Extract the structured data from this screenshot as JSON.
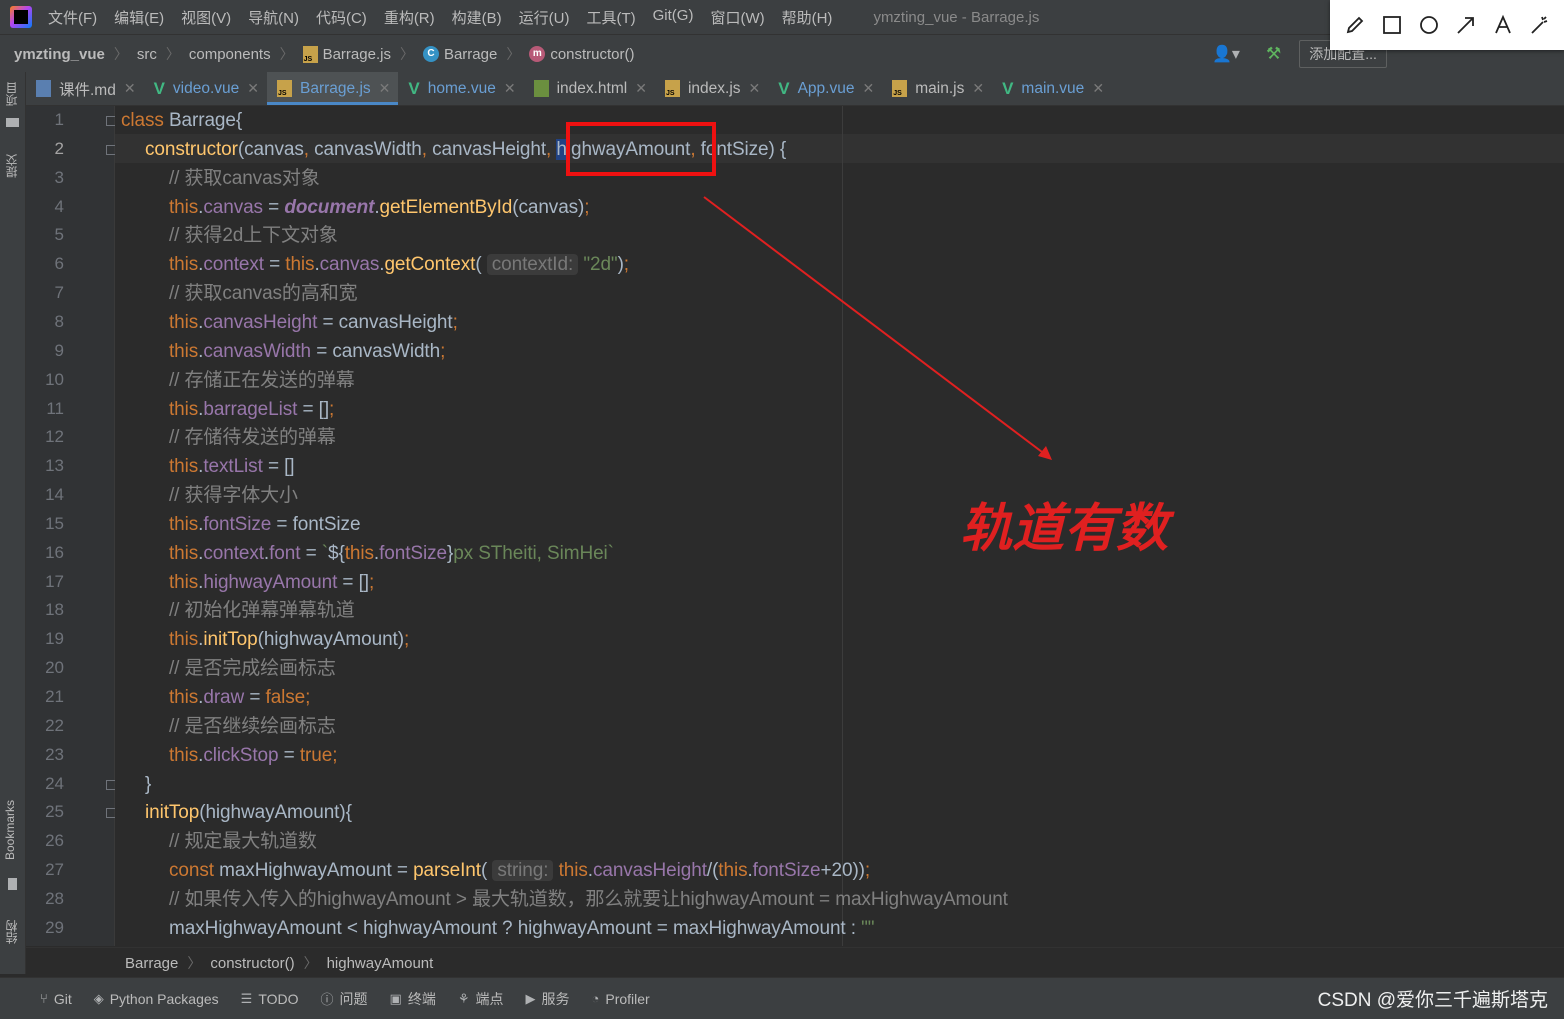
{
  "menubar": {
    "items": [
      "文件(F)",
      "编辑(E)",
      "视图(V)",
      "导航(N)",
      "代码(C)",
      "重构(R)",
      "构建(B)",
      "运行(U)",
      "工具(T)",
      "Git(G)",
      "窗口(W)",
      "帮助(H)"
    ],
    "window_title": "ymzting_vue - Barrage.js"
  },
  "annotation_tools": [
    "pencil-icon",
    "rectangle-icon",
    "circle-icon",
    "arrow-icon",
    "text-icon",
    "magic-wand-icon"
  ],
  "navbar": {
    "project": "ymzting_vue",
    "crumbs": [
      "src",
      "components",
      "Barrage.js",
      "Barrage",
      "constructor()"
    ],
    "add_config": "添加配置..."
  },
  "left_strip": {
    "project_label": "项目",
    "commit_label": "提交",
    "bookmarks_label": "Bookmarks",
    "structure_label": "结构"
  },
  "tabs": [
    {
      "name": "课件.md",
      "type": "md"
    },
    {
      "name": "video.vue",
      "type": "vue"
    },
    {
      "name": "Barrage.js",
      "type": "js",
      "active": true
    },
    {
      "name": "home.vue",
      "type": "vue"
    },
    {
      "name": "index.html",
      "type": "html"
    },
    {
      "name": "index.js",
      "type": "js"
    },
    {
      "name": "App.vue",
      "type": "vue"
    },
    {
      "name": "main.js",
      "type": "js"
    },
    {
      "name": "main.vue",
      "type": "vue"
    }
  ],
  "editor": {
    "line_numbers": [
      "1",
      "2",
      "3",
      "4",
      "5",
      "6",
      "7",
      "8",
      "9",
      "10",
      "11",
      "12",
      "13",
      "14",
      "15",
      "16",
      "17",
      "18",
      "19",
      "20",
      "21",
      "22",
      "23",
      "24",
      "25",
      "26",
      "27",
      "28",
      "29"
    ],
    "lines": [
      [
        [
          "kw",
          "class "
        ],
        [
          "",
          "Barrage{"
        ]
      ],
      [
        [
          "fn",
          "constructor"
        ],
        [
          "",
          "(canvas"
        ],
        [
          "kw",
          ", "
        ],
        [
          "",
          "canvasWidth"
        ],
        [
          "kw",
          ", "
        ],
        [
          "",
          "canvasHeight"
        ],
        [
          "kw",
          ", "
        ],
        [
          "sel",
          "h"
        ],
        [
          "",
          "ighwayAmount"
        ],
        [
          "kw",
          ", "
        ],
        [
          "",
          "fontSize) {"
        ]
      ],
      [
        [
          "cm",
          "// 获取canvas对象"
        ]
      ],
      [
        [
          "th",
          "this"
        ],
        [
          "",
          "."
        ],
        [
          "pr",
          "canvas"
        ],
        [
          "",
          " = "
        ],
        [
          "doc",
          "document"
        ],
        [
          "",
          "."
        ],
        [
          "fn",
          "getElementById"
        ],
        [
          "",
          "(canvas)"
        ],
        [
          "kw",
          ";"
        ]
      ],
      [
        [
          "cm",
          "// 获得2d上下文对象"
        ]
      ],
      [
        [
          "th",
          "this"
        ],
        [
          "",
          "."
        ],
        [
          "pr",
          "context"
        ],
        [
          "",
          " = "
        ],
        [
          "th",
          "this"
        ],
        [
          "",
          "."
        ],
        [
          "pr",
          "canvas"
        ],
        [
          "",
          "."
        ],
        [
          "fn",
          "getContext"
        ],
        [
          "",
          "( "
        ],
        [
          "hint",
          "contextId:"
        ],
        [
          "",
          " "
        ],
        [
          "str",
          "\"2d\""
        ],
        [
          "",
          ")"
        ],
        [
          "kw",
          ";"
        ]
      ],
      [
        [
          "cm",
          "// 获取canvas的高和宽"
        ]
      ],
      [
        [
          "th",
          "this"
        ],
        [
          "",
          "."
        ],
        [
          "pr",
          "canvasHeight"
        ],
        [
          "",
          " = canvasHeight"
        ],
        [
          "kw",
          ";"
        ]
      ],
      [
        [
          "th",
          "this"
        ],
        [
          "",
          "."
        ],
        [
          "pr",
          "canvasWidth"
        ],
        [
          "",
          " = canvasWidth"
        ],
        [
          "kw",
          ";"
        ]
      ],
      [
        [
          "cm",
          "// 存储正在发送的弹幕"
        ]
      ],
      [
        [
          "th",
          "this"
        ],
        [
          "",
          "."
        ],
        [
          "pr",
          "barrageList"
        ],
        [
          "",
          " = []"
        ],
        [
          "kw",
          ";"
        ]
      ],
      [
        [
          "cm",
          "// 存储待发送的弹幕"
        ]
      ],
      [
        [
          "th",
          "this"
        ],
        [
          "",
          "."
        ],
        [
          "pr",
          "textList"
        ],
        [
          "",
          " = []"
        ]
      ],
      [
        [
          "cm",
          "// 获得字体大小"
        ]
      ],
      [
        [
          "th",
          "this"
        ],
        [
          "",
          "."
        ],
        [
          "pr",
          "fontSize"
        ],
        [
          "",
          " = fontSize"
        ]
      ],
      [
        [
          "th",
          "this"
        ],
        [
          "",
          "."
        ],
        [
          "pr",
          "context"
        ],
        [
          "",
          "."
        ],
        [
          "pr",
          "font"
        ],
        [
          "",
          " = "
        ],
        [
          "str",
          "`"
        ],
        [
          "",
          "${"
        ],
        [
          "th",
          "this"
        ],
        [
          "",
          "."
        ],
        [
          "pr",
          "fontSize"
        ],
        [
          "",
          "}"
        ],
        [
          "str",
          "px STheiti, SimHei`"
        ]
      ],
      [
        [
          "th",
          "this"
        ],
        [
          "",
          "."
        ],
        [
          "pr",
          "highwayAmount"
        ],
        [
          "",
          " = []"
        ],
        [
          "kw",
          ";"
        ]
      ],
      [
        [
          "cm",
          "// 初始化弹幕弹幕轨道"
        ]
      ],
      [
        [
          "th",
          "this"
        ],
        [
          "",
          "."
        ],
        [
          "fn",
          "initTop"
        ],
        [
          "",
          "(highwayAmount)"
        ],
        [
          "kw",
          ";"
        ]
      ],
      [
        [
          "cm",
          "// 是否完成绘画标志"
        ]
      ],
      [
        [
          "th",
          "this"
        ],
        [
          "",
          "."
        ],
        [
          "pr",
          "draw"
        ],
        [
          "",
          " = "
        ],
        [
          "kw",
          "false"
        ],
        [
          "kw",
          ";"
        ]
      ],
      [
        [
          "cm",
          "// 是否继续绘画标志"
        ]
      ],
      [
        [
          "th",
          "this"
        ],
        [
          "",
          "."
        ],
        [
          "pr",
          "clickStop"
        ],
        [
          "",
          " = "
        ],
        [
          "kw",
          "true"
        ],
        [
          "kw",
          ";"
        ]
      ],
      [
        [
          "",
          "}"
        ]
      ],
      [
        [
          "fn",
          "initTop"
        ],
        [
          "",
          "(highwayAmount){"
        ]
      ],
      [
        [
          "cm",
          "// 规定最大轨道数"
        ]
      ],
      [
        [
          "kw",
          "const "
        ],
        [
          "",
          "maxHighwayAmount = "
        ],
        [
          "fn",
          "parseInt"
        ],
        [
          "",
          "( "
        ],
        [
          "hint",
          "string:"
        ],
        [
          "",
          " "
        ],
        [
          "th",
          "this"
        ],
        [
          "",
          "."
        ],
        [
          "pr",
          "canvasHeight"
        ],
        [
          "",
          "/("
        ],
        [
          "th",
          "this"
        ],
        [
          "",
          "."
        ],
        [
          "pr",
          "fontSize"
        ],
        [
          "",
          "+20))"
        ],
        [
          "kw",
          ";"
        ]
      ],
      [
        [
          "cm",
          "// 如果传入传入的highwayAmount > 最大轨道数，那么就要让highwayAmount = maxHighwayAmount"
        ]
      ],
      [
        [
          "",
          "maxHighwayAmount < highwayAmount ? highwayAmount = maxHighwayAmount : "
        ],
        [
          "str",
          "\"\""
        ]
      ]
    ]
  },
  "annotation": {
    "label": "轨道有数",
    "color": "#e02020"
  },
  "code_crumbs": [
    "Barrage",
    "constructor()",
    "highwayAmount"
  ],
  "statusbar": {
    "items": [
      {
        "icon": "git-icon",
        "label": "Git"
      },
      {
        "icon": "python-packages-icon",
        "label": "Python Packages"
      },
      {
        "icon": "todo-icon",
        "label": "TODO"
      },
      {
        "icon": "problems-icon",
        "label": "问题"
      },
      {
        "icon": "terminal-icon",
        "label": "终端"
      },
      {
        "icon": "endpoints-icon",
        "label": "端点"
      },
      {
        "icon": "services-icon",
        "label": "服务"
      },
      {
        "icon": "profiler-icon",
        "label": "Profiler"
      }
    ],
    "watermark": "CSDN @爱你三千遍斯塔克"
  }
}
